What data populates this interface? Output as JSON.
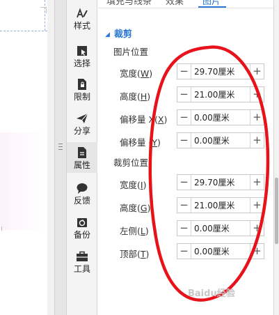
{
  "tabs": [
    "填充与线条",
    "效果",
    "图片"
  ],
  "active_tab": "图片",
  "sidebar": [
    {
      "label": "样式",
      "icon": "style-pen-icon"
    },
    {
      "label": "选择",
      "icon": "select-cursor-icon"
    },
    {
      "label": "限制",
      "icon": "restrict-doc-icon"
    },
    {
      "label": "分享",
      "icon": "share-plane-icon"
    },
    {
      "label": "属性",
      "icon": "properties-doc-icon"
    },
    {
      "label": "反馈",
      "icon": "feedback-bubble-icon"
    },
    {
      "label": "备份",
      "icon": "backup-icon"
    },
    {
      "label": "工具",
      "icon": "toolbox-icon"
    }
  ],
  "active_sidebar": "属性",
  "section": {
    "title": "裁剪"
  },
  "groups": [
    {
      "title": "图片位置",
      "rows": [
        {
          "label": "宽度(",
          "key": "W",
          "end": ")",
          "value": "29.70厘米"
        },
        {
          "label": "高度(",
          "key": "H",
          "end": ")",
          "value": "21.00厘米"
        },
        {
          "label": "偏移量 X(",
          "key": "X",
          "end": ")",
          "value": "0.00厘米"
        },
        {
          "label": "偏移量 (",
          "key": "Y",
          "end": ")",
          "value": "0.00厘米"
        }
      ]
    },
    {
      "title": "裁剪位置",
      "rows": [
        {
          "label": "宽度(",
          "key": "I",
          "end": ")",
          "value": "29.70厘米"
        },
        {
          "label": "高度(",
          "key": "G",
          "end": ")",
          "value": "21.00厘米"
        },
        {
          "label": "左侧(",
          "key": "L",
          "end": ")",
          "value": "0.00厘米"
        },
        {
          "label": "顶部(",
          "key": "T",
          "end": ")",
          "value": "0.00厘米"
        }
      ]
    }
  ],
  "stepper": {
    "minus": "−",
    "plus": "+"
  },
  "watermark": "Baidu经验",
  "colors": {
    "accent": "#2a78d0",
    "annotation": "#e8121b"
  }
}
